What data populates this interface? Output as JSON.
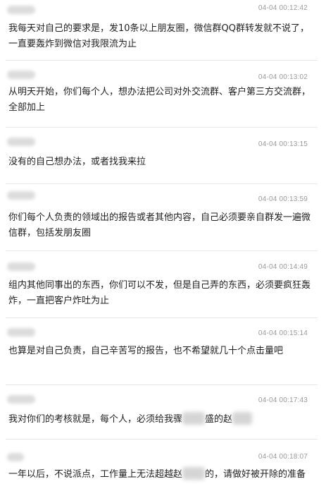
{
  "messages": [
    {
      "time": "04-04 00:12:42",
      "text": "我每天对自己的要求是，发10条以上朋友圈，微信群QQ群转发就不说了，一直要轰炸到微信对我限流为止"
    },
    {
      "time": "04-04 00:13:02",
      "text": "从明天开始，你们每个人，想办法把公司对外交流群、客户第三方交流群，全部加上"
    },
    {
      "time": "04-04 00:13:15",
      "text": "没有的自己想办法，或者找我来拉"
    },
    {
      "time": "04-04 00:13:59",
      "text": "你们每个人负责的领域出的报告或者其他内容，自己必须要亲自群发一遍微信群，包括发朋友圈"
    },
    {
      "time": "04-04 00:14:49",
      "text": "组内其他同事出的东西，你们可以不发，但是自己弄的东西，必须要疯狂轰炸，一直把客户炸吐为止"
    },
    {
      "time": "04-04 00:15:14",
      "text": "也算是对自己负责，自己辛苦写的报告，也不希望就几十个点击量吧"
    },
    {
      "time": "04-04 00:17:43",
      "text_a": "我对你们的考核就是，每个人，必须给我骤",
      "text_b": "盛的",
      "text_c": "赵"
    },
    {
      "time": "04-04 00:18:07",
      "text_a": "一年以后，不说派点，工作量上无法超越赵",
      "text_b": "的，请做好被开除的准备"
    }
  ]
}
